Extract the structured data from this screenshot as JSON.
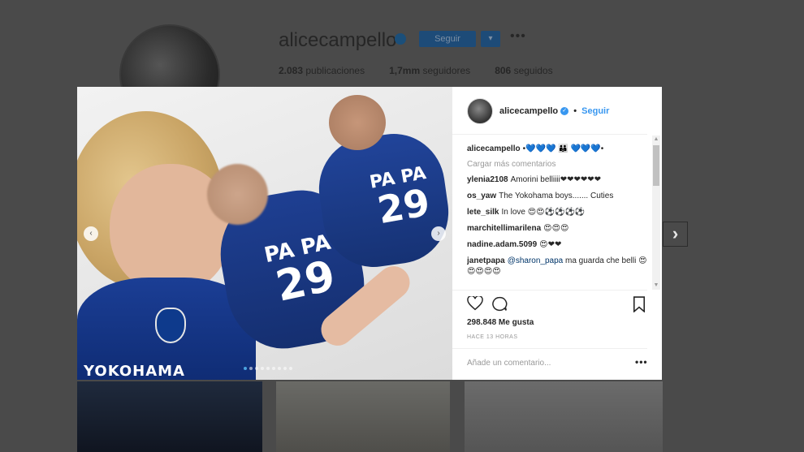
{
  "background_profile": {
    "username": "alicecampello",
    "follow_button": "Seguir",
    "dropdown_label": "▾",
    "more_label": "•••",
    "stats": {
      "posts": "2.083",
      "posts_label": "publicaciones",
      "followers": "1,7mm",
      "followers_label": "seguidores",
      "following": "806",
      "following_label": "seguidos"
    }
  },
  "photo": {
    "jersey_back_name": "PA PA",
    "jersey_number": "29",
    "jersey_back_name_2": "PA PA",
    "jersey_number_2": "29",
    "sponsor": "YOKOHAMA",
    "prev_glyph": "‹",
    "next_glyph": "›"
  },
  "post_header": {
    "username": "alicecampello",
    "verified_glyph": "✓",
    "separator": "•",
    "follow_link": "Seguir"
  },
  "caption": {
    "username": "alicecampello",
    "text": "•💙💙💙 👪 💙💙💙•"
  },
  "load_more": "Cargar más comentarios",
  "comments": [
    {
      "username": "ylenia2108",
      "text": "Amorini belliiii❤❤❤❤❤❤"
    },
    {
      "username": "os_yaw",
      "text": "The Yokohama boys....... Cuties"
    },
    {
      "username": "lete_silk",
      "text": "In love 😍😍⚽⚽⚽⚽"
    },
    {
      "username": "marchitellimarilena",
      "text": "😍😍😍"
    },
    {
      "username": "nadine.adam.5099",
      "text": "😍❤❤"
    },
    {
      "username": "janetpapa",
      "mention": "@sharon_papa",
      "text": "ma guarda che belli 😍😍😍😍😍"
    }
  ],
  "scroll": {
    "up": "▲",
    "down": "▼"
  },
  "likes": "298.848 Me gusta",
  "timestamp": "HACE 13 HORAS",
  "comment_input": {
    "placeholder": "Añade un comentario..."
  },
  "more_options": "•••",
  "next_post_arrow": "›",
  "colors": {
    "accent": "#3897f0",
    "text": "#262626",
    "muted": "#999999",
    "overlay": "#474747"
  }
}
